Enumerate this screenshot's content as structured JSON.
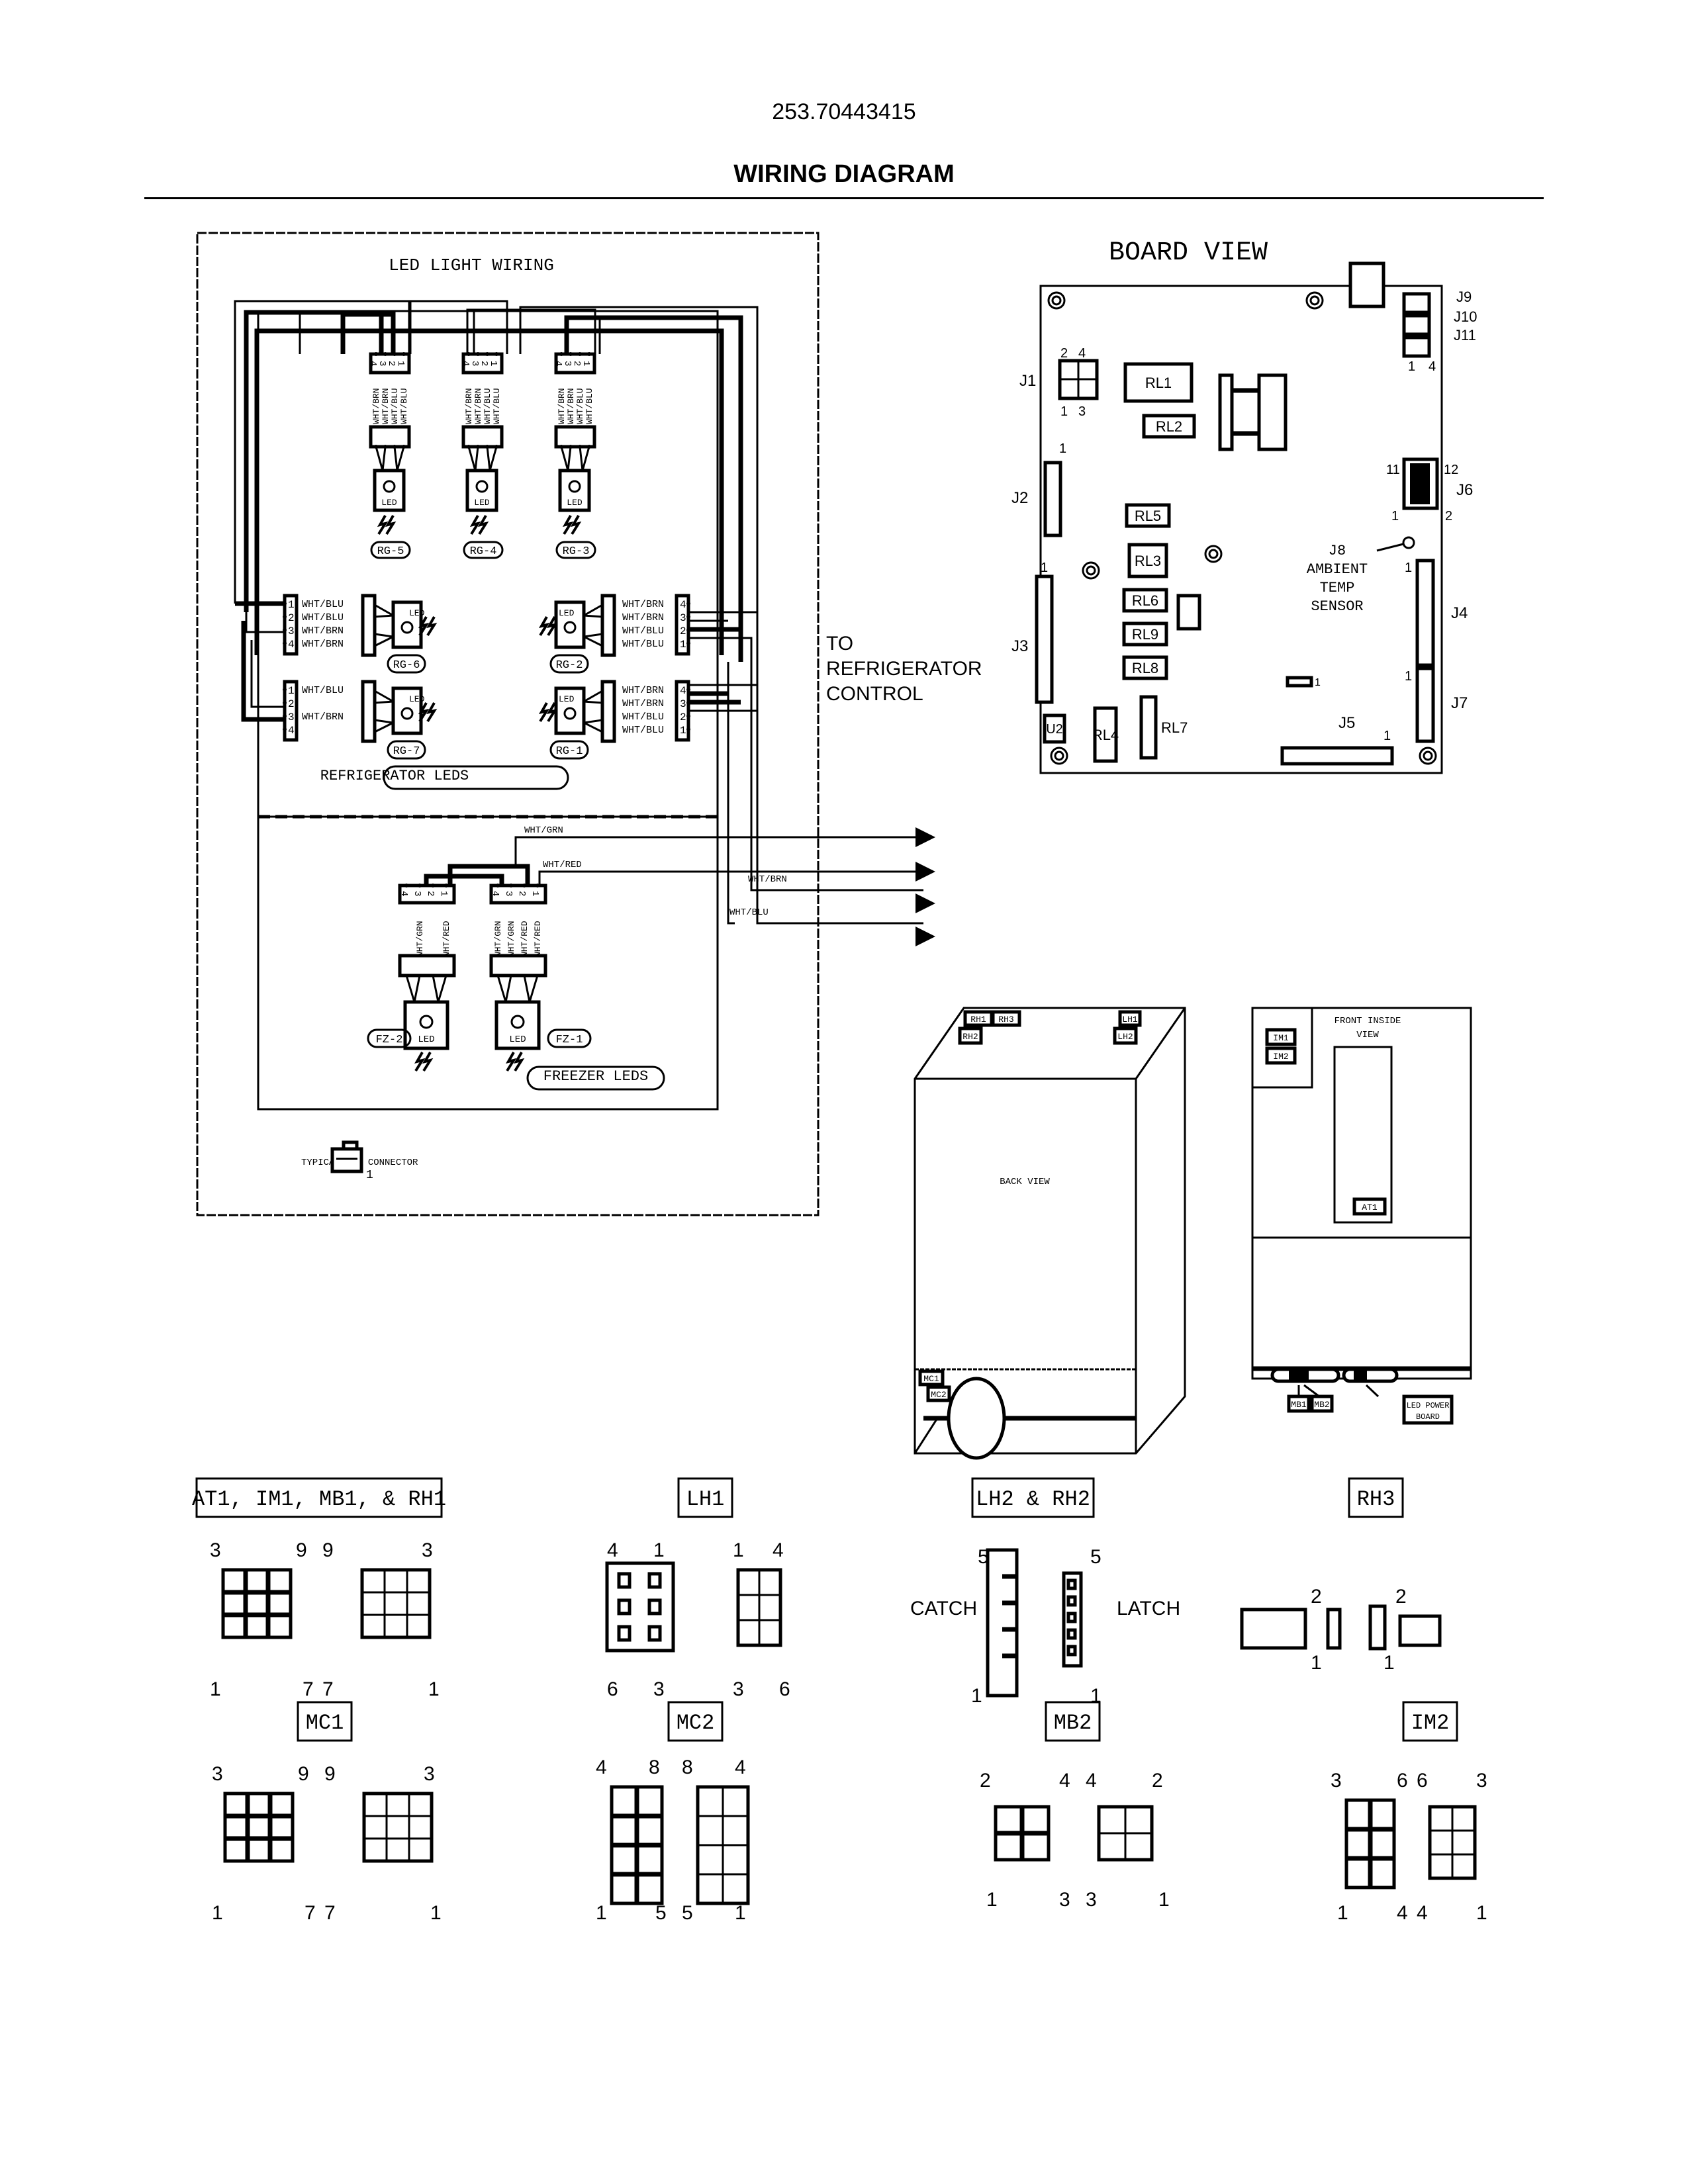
{
  "header": {
    "doc_number": "253.70443415",
    "title": "WIRING DIAGRAM"
  },
  "led_wiring": {
    "title": "LED LIGHT WIRING",
    "led_label": "LED",
    "top_connector_pins": [
      "4",
      "3",
      "2",
      "1"
    ],
    "top_wire_colors": [
      "WHT/BRN",
      "WHT/BRN",
      "WHT/BLU",
      "WHT/BLU"
    ],
    "top_leds": [
      {
        "id": "RG-5"
      },
      {
        "id": "RG-4"
      },
      {
        "id": "RG-3"
      }
    ],
    "left_connectors": [
      {
        "pins": [
          "1",
          "2",
          "3",
          "4"
        ],
        "wires": [
          "WHT/BLU",
          "WHT/BLU",
          "WHT/BRN",
          "WHT/BRN"
        ],
        "led": "RG-6"
      },
      {
        "pins": [
          "1",
          "2",
          "3",
          "4"
        ],
        "wires": [
          "WHT/BLU",
          "",
          "WHT/BRN",
          ""
        ],
        "led": "RG-7"
      }
    ],
    "right_connectors": [
      {
        "pins": [
          "4",
          "3",
          "2",
          "1"
        ],
        "wires": [
          "WHT/BRN",
          "WHT/BRN",
          "WHT/BLU",
          "WHT/BLU"
        ],
        "led": "RG-2"
      },
      {
        "pins": [
          "4",
          "3",
          "2",
          "1"
        ],
        "wires": [
          "WHT/BRN",
          "WHT/BRN",
          "WHT/BLU",
          "WHT/BLU"
        ],
        "led": "RG-1"
      }
    ],
    "refrigerator_section_label": "REFRIGERATOR LEDS",
    "freezer": {
      "section_label": "FREEZER LEDS",
      "fz2": {
        "id": "FZ-2",
        "pins": [
          "4",
          "3",
          "2",
          "1"
        ],
        "wires": [
          "WHT/GRN",
          "WHT/RED"
        ]
      },
      "fz1": {
        "id": "FZ-1",
        "pins": [
          "4",
          "3",
          "2",
          "1"
        ],
        "wires": [
          "WHT/GRN",
          "WHT/GRN",
          "WHT/RED",
          "WHT/RED"
        ]
      }
    },
    "output_wires": [
      "WHT/GRN",
      "WHT/RED",
      "WHT/BRN",
      "WHT/BLU"
    ],
    "to_control_label": [
      "TO",
      "REFRIGERATOR",
      "CONTROL"
    ],
    "typical_connector_label": "TYPICAL LED CONNECTOR",
    "typical_connector_pin": "1"
  },
  "board_view": {
    "title": "BOARD VIEW",
    "relays": [
      "RL1",
      "RL2",
      "RL5",
      "RL3",
      "RL6",
      "RL9",
      "RL8",
      "RL4",
      "RL7"
    ],
    "u2": "U2",
    "connectors": {
      "J1": {
        "label": "J1",
        "pins_top": [
          "2",
          "4"
        ],
        "pins_bottom": [
          "1",
          "3"
        ]
      },
      "J2": {
        "label": "J2",
        "pin": "1"
      },
      "J3": {
        "label": "J3",
        "pin": "1"
      },
      "J4": {
        "label": "J4",
        "pin": "1"
      },
      "J5": {
        "label": "J5",
        "pin": "1"
      },
      "J6": {
        "label": "J6",
        "pins": [
          "11",
          "12",
          "1",
          "2"
        ]
      },
      "J7": {
        "label": "J7",
        "pin": "1"
      },
      "J9": {
        "label": "J9"
      },
      "J10": {
        "label": "J10"
      },
      "J11": {
        "label": "J11",
        "pins": [
          "1",
          "4"
        ]
      },
      "small_header_pin": "1"
    },
    "sensor": [
      "J8",
      "AMBIENT",
      "TEMP",
      "SENSOR"
    ]
  },
  "back_view": {
    "label": "BACK VIEW",
    "tags": [
      "RH1",
      "RH3",
      "RH2",
      "LH1",
      "LH2",
      "MC1",
      "MC2"
    ]
  },
  "front_view": {
    "label": [
      "FRONT INSIDE",
      "VIEW"
    ],
    "tags": [
      "IM1",
      "IM2",
      "AT1",
      "MB1",
      "MB2"
    ],
    "led_power_board": [
      "LED POWER",
      "BOARD"
    ]
  },
  "connector_details": [
    {
      "title": "AT1, IM1, MB1, & RH1",
      "left_pins": [
        "3",
        "9",
        "1",
        "7"
      ],
      "right_pins": [
        "9",
        "3",
        "7",
        "1"
      ]
    },
    {
      "title": "LH1",
      "left_pins": [
        "4",
        "1",
        "6",
        "3"
      ],
      "right_pins": [
        "1",
        "4",
        "3",
        "6"
      ]
    },
    {
      "title": "LH2 & RH2",
      "left_pins": [
        "5",
        "1"
      ],
      "right_pins": [
        "5",
        "1"
      ],
      "catch_label": "CATCH",
      "latch_label": "LATCH"
    },
    {
      "title": "RH3",
      "left_pins": [
        "2",
        "1"
      ],
      "right_pins": [
        "2",
        "1"
      ]
    },
    {
      "title": "MC1",
      "left_pins": [
        "3",
        "9",
        "1",
        "7"
      ],
      "right_pins": [
        "9",
        "3",
        "7",
        "1"
      ]
    },
    {
      "title": "MC2",
      "left_pins": [
        "4",
        "8",
        "1",
        "5"
      ],
      "right_pins": [
        "8",
        "4",
        "5",
        "1"
      ]
    },
    {
      "title": "MB2",
      "left_pins": [
        "2",
        "4",
        "1",
        "3"
      ],
      "right_pins": [
        "4",
        "2",
        "3",
        "1"
      ]
    },
    {
      "title": "IM2",
      "left_pins": [
        "3",
        "6",
        "1",
        "4"
      ],
      "right_pins": [
        "6",
        "3",
        "4",
        "1"
      ]
    }
  ]
}
